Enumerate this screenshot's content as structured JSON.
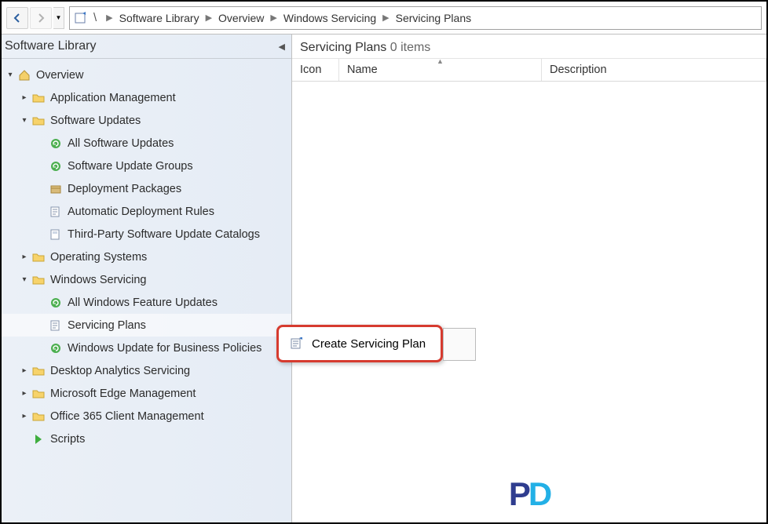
{
  "breadcrumb": {
    "root": "\\",
    "items": [
      "Software Library",
      "Overview",
      "Windows Servicing",
      "Servicing Plans"
    ]
  },
  "sidebar": {
    "title": "Software Library",
    "nodes": [
      {
        "label": "Overview",
        "icon": "home",
        "indent": 0,
        "expander": "down"
      },
      {
        "label": "Application Management",
        "icon": "folder",
        "indent": 1,
        "expander": "right"
      },
      {
        "label": "Software Updates",
        "icon": "folder",
        "indent": 1,
        "expander": "down"
      },
      {
        "label": "All Software Updates",
        "icon": "update-green",
        "indent": 2,
        "expander": ""
      },
      {
        "label": "Software Update Groups",
        "icon": "update-green",
        "indent": 2,
        "expander": ""
      },
      {
        "label": "Deployment Packages",
        "icon": "package",
        "indent": 2,
        "expander": ""
      },
      {
        "label": "Automatic Deployment Rules",
        "icon": "rules",
        "indent": 2,
        "expander": ""
      },
      {
        "label": "Third-Party Software Update Catalogs",
        "icon": "catalog",
        "indent": 2,
        "expander": ""
      },
      {
        "label": "Operating Systems",
        "icon": "folder",
        "indent": 1,
        "expander": "right"
      },
      {
        "label": "Windows Servicing",
        "icon": "folder",
        "indent": 1,
        "expander": "down"
      },
      {
        "label": "All Windows Feature Updates",
        "icon": "update-green",
        "indent": 2,
        "expander": ""
      },
      {
        "label": "Servicing Plans",
        "icon": "rules",
        "indent": 2,
        "expander": "",
        "selected": true
      },
      {
        "label": "Windows Update for Business Policies",
        "icon": "update-green",
        "indent": 2,
        "expander": ""
      },
      {
        "label": "Desktop Analytics Servicing",
        "icon": "folder",
        "indent": 1,
        "expander": "right"
      },
      {
        "label": "Microsoft Edge Management",
        "icon": "folder",
        "indent": 1,
        "expander": "right"
      },
      {
        "label": "Office 365 Client Management",
        "icon": "folder",
        "indent": 1,
        "expander": "right"
      },
      {
        "label": "Scripts",
        "icon": "script",
        "indent": 1,
        "expander": ""
      }
    ]
  },
  "content": {
    "title": "Servicing Plans",
    "count_label": "0 items",
    "columns": {
      "icon": "Icon",
      "name": "Name",
      "desc": "Description"
    }
  },
  "context_menu": {
    "items": [
      {
        "label": "Create Servicing Plan",
        "icon": "rules"
      }
    ]
  },
  "logo": {
    "p": "P",
    "d": "D"
  }
}
